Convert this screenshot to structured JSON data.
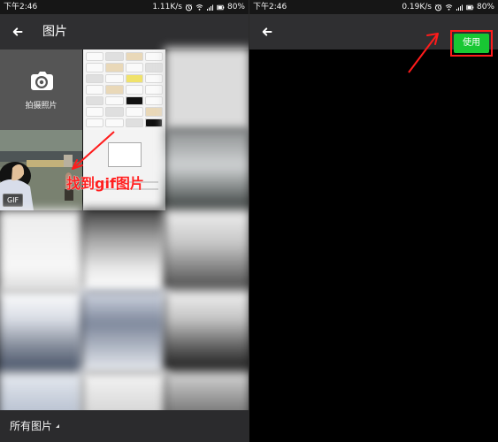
{
  "left_status": {
    "time": "下午2:46",
    "speed": "1.11K/s",
    "battery": "80%"
  },
  "right_status": {
    "time": "下午2:46",
    "speed": "0.19K/s",
    "battery": "80%"
  },
  "left_header": {
    "title": "图片"
  },
  "camera_tile": {
    "label": "拍摄照片"
  },
  "gif_tile": {
    "badge": "GIF"
  },
  "annotation": {
    "left_text": "找到gif图片"
  },
  "bottom_bar": {
    "album_label": "所有图片"
  },
  "right_header": {
    "use_label": "使用"
  },
  "colors": {
    "accent_green": "#18c733",
    "annotation_red": "#ff1b1b",
    "toolbar_dark": "#2f2f31"
  },
  "icons": {
    "back": "back-arrow-icon",
    "camera": "camera-icon",
    "dropdown": "triangle-down-icon"
  }
}
